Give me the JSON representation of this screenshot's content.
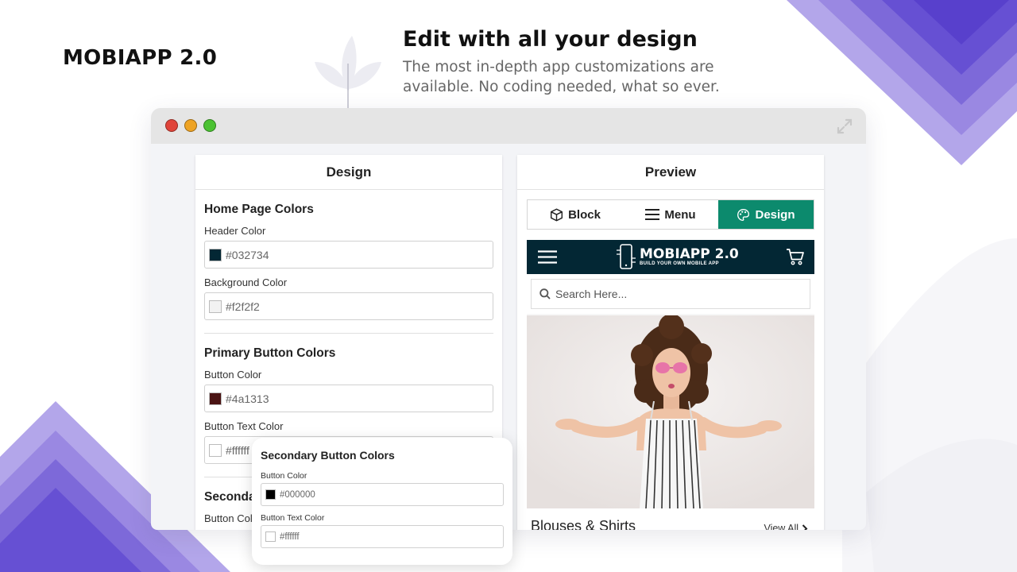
{
  "page": {
    "brand": "MOBIAPP 2.0",
    "headline": "Edit with all your design",
    "subtext": "The most in-depth app customizations are available. No coding needed, what so ever."
  },
  "design_panel": {
    "title": "Design",
    "sections": [
      {
        "title": "Home Page Colors",
        "fields": [
          {
            "label": "Header Color",
            "value": "#032734",
            "swatch": "#032734"
          },
          {
            "label": "Background Color",
            "value": "#f2f2f2",
            "swatch": "#f2f2f2"
          }
        ]
      },
      {
        "title": "Primary Button Colors",
        "fields": [
          {
            "label": "Button Color",
            "value": "#4a1313",
            "swatch": "#4a1313"
          },
          {
            "label": "Button Text Color",
            "value": "#ffffff",
            "swatch": "#ffffff"
          }
        ]
      },
      {
        "title": "Secondary Button Colors",
        "fields": [
          {
            "label": "Button Color",
            "value": "#000000",
            "swatch": "#000000"
          }
        ]
      }
    ]
  },
  "popup": {
    "title": "Secondary Button Colors",
    "fields": [
      {
        "label": "Button Color",
        "value": "#000000",
        "swatch": "#000000"
      },
      {
        "label": "Button Text Color",
        "value": "#ffffff",
        "swatch": "#ffffff"
      }
    ]
  },
  "preview_panel": {
    "title": "Preview",
    "tabs": [
      {
        "label": "Block",
        "icon": "cube-icon"
      },
      {
        "label": "Menu",
        "icon": "menu-icon"
      },
      {
        "label": "Design",
        "icon": "palette-icon",
        "active": true
      }
    ],
    "app": {
      "logo_title": "MOBIAPP 2.0",
      "logo_subtitle": "BUILD YOUR OWN MOBILE APP",
      "search_placeholder": "Search Here...",
      "collection_title": "Blouses & Shirts",
      "view_all": "View All"
    }
  },
  "colors": {
    "accent_purple": "#5b3fd1",
    "active_tab": "#0c8a6d",
    "app_header": "#032734"
  }
}
